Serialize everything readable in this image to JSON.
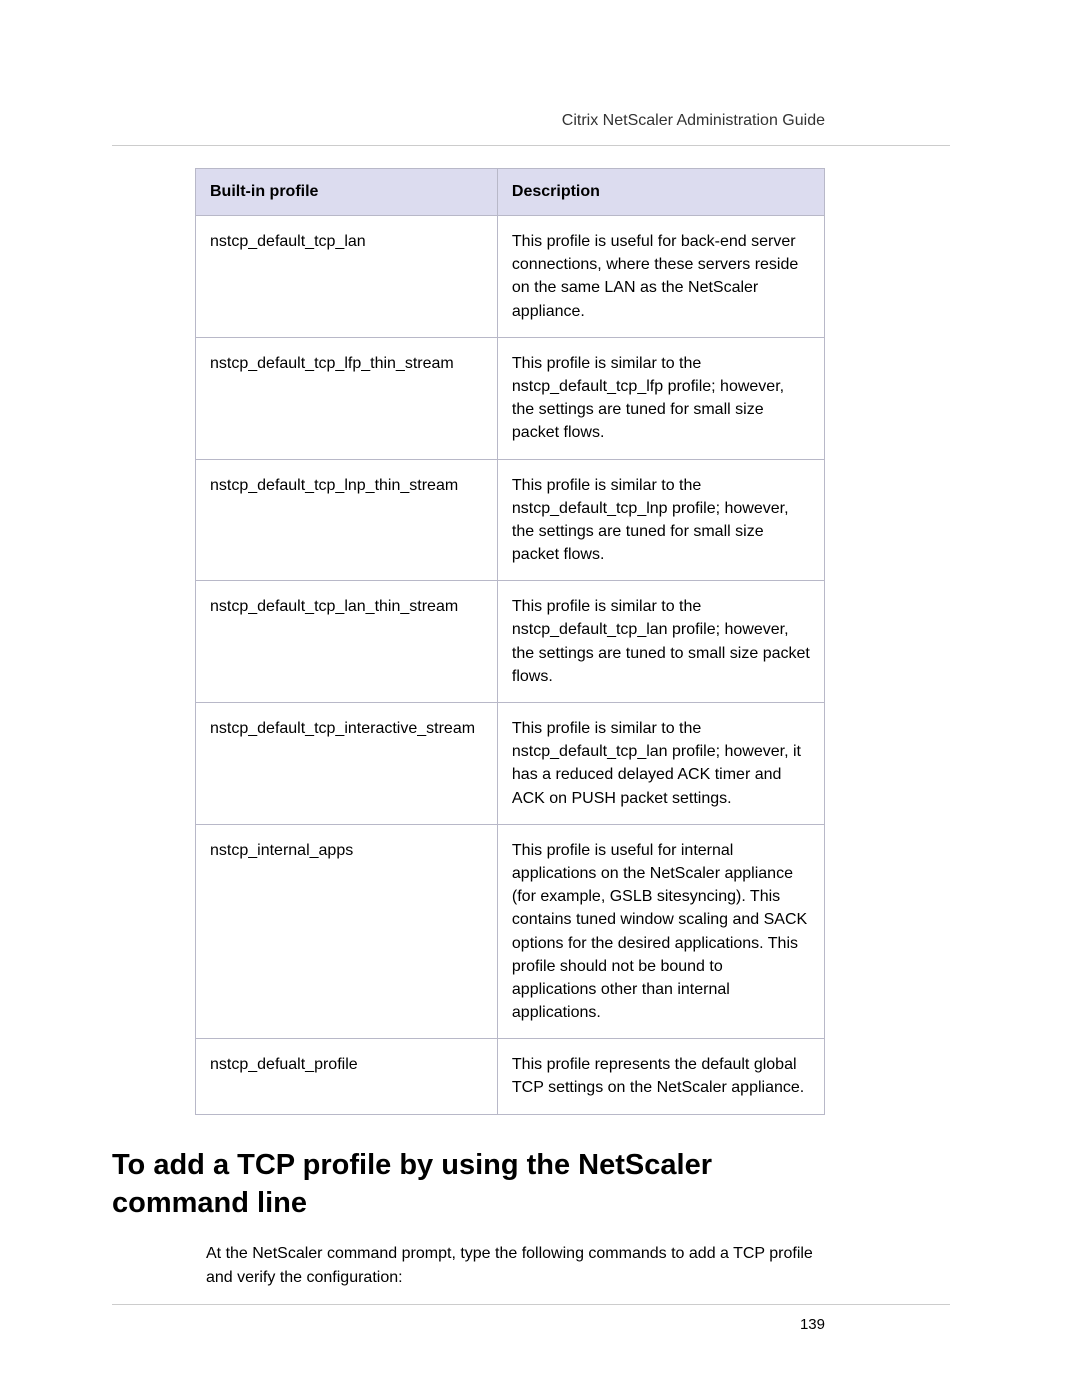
{
  "document_title": "Citrix NetScaler Administration Guide",
  "page_number": "139",
  "table": {
    "headers": {
      "profile": "Built-in profile",
      "description": "Description"
    },
    "rows": [
      {
        "profile": "nstcp_default_tcp_lan",
        "description": "This profile is useful for back-end server connections, where these servers reside on the same LAN as the NetScaler appliance."
      },
      {
        "profile": "nstcp_default_tcp_lfp_thin_stream",
        "description": "This profile is similar to the nstcp_default_tcp_lfp profile; however, the settings are tuned for small size packet flows."
      },
      {
        "profile": "nstcp_default_tcp_lnp_thin_stream",
        "description": "This profile is similar to the nstcp_default_tcp_lnp profile; however, the settings are tuned for small size packet flows."
      },
      {
        "profile": "nstcp_default_tcp_lan_thin_stream",
        "description": "This profile is similar to the nstcp_default_tcp_lan profile; however, the settings are tuned to small size packet flows."
      },
      {
        "profile": "nstcp_default_tcp_interactive_stream",
        "description": "This profile is similar to the nstcp_default_tcp_lan profile; however, it has a reduced delayed ACK timer and ACK on PUSH packet settings."
      },
      {
        "profile": "nstcp_internal_apps",
        "description": "This profile is useful for internal applications on the NetScaler appliance (for example, GSLB sitesyncing). This contains tuned window scaling and SACK options for the desired applications. This profile should not be bound to applications other than internal applications."
      },
      {
        "profile": "nstcp_defualt_profile",
        "description": "This profile represents the default global TCP settings on the NetScaler appliance."
      }
    ]
  },
  "section_heading": "To add a TCP profile by using the NetScaler command line",
  "body_paragraph": "At the NetScaler command prompt, type the following commands to add a TCP profile and verify the configuration:"
}
